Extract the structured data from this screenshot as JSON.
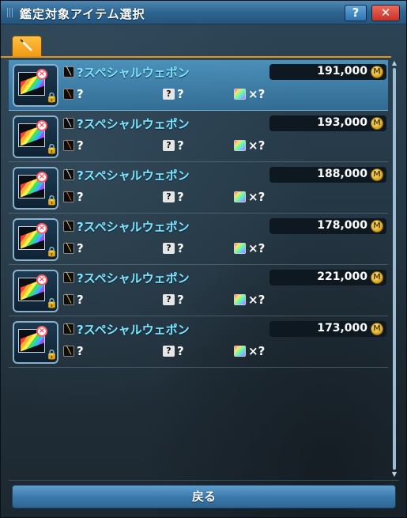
{
  "window": {
    "title": "鑑定対象アイテム選択",
    "help_label": "?",
    "close_label": "✕"
  },
  "tab": {
    "icon": "sword-icon"
  },
  "items": [
    {
      "name": "?スペシャルウェポン",
      "price": "191,000",
      "element": "?",
      "potential": "?",
      "slots": "×?",
      "selected": true,
      "type_icon": "sword-icon",
      "element_icon": "fire-icon"
    },
    {
      "name": "?スペシャルウェポン",
      "price": "193,000",
      "element": "?",
      "potential": "?",
      "slots": "×?",
      "selected": false,
      "type_icon": "sword-icon",
      "element_icon": "fire-icon"
    },
    {
      "name": "?スペシャルウェポン",
      "price": "188,000",
      "element": "?",
      "potential": "?",
      "slots": "×?",
      "selected": false,
      "type_icon": "sword-icon",
      "element_icon": "fire-icon"
    },
    {
      "name": "?スペシャルウェポン",
      "price": "178,000",
      "element": "?",
      "potential": "?",
      "slots": "×?",
      "selected": false,
      "type_icon": "sword-icon",
      "element_icon": "key-icon"
    },
    {
      "name": "?スペシャルウェポン",
      "price": "221,000",
      "element": "?",
      "potential": "?",
      "slots": "×?",
      "selected": false,
      "type_icon": "sword-icon",
      "element_icon": "key-icon"
    },
    {
      "name": "?スペシャルウェポン",
      "price": "173,000",
      "element": "?",
      "potential": "?",
      "slots": "×?",
      "selected": false,
      "type_icon": "sword-icon",
      "element_icon": "key-icon"
    }
  ],
  "footer": {
    "back_label": "戻る"
  },
  "colors": {
    "name": "#7fe6ff",
    "selected_row": "#4a9ed2",
    "tab": "#f5a623"
  }
}
